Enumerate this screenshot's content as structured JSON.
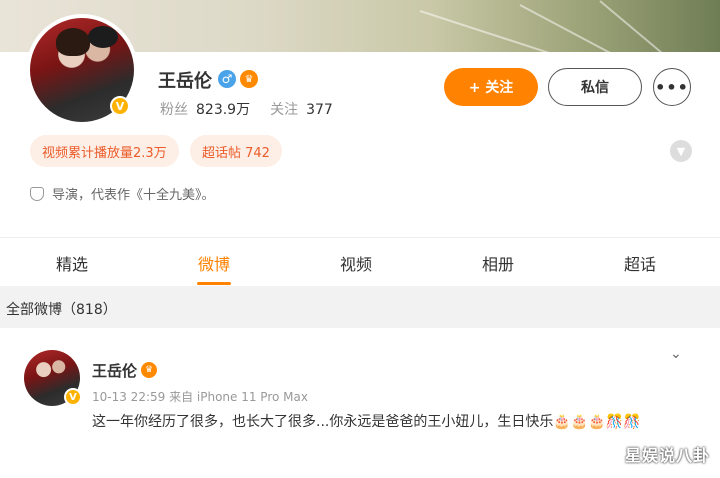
{
  "profile": {
    "name": "王岳伦",
    "followers_label": "粉丝",
    "followers_value": "823.9万",
    "following_label": "关注",
    "following_value": "377",
    "verified_badge": "V",
    "tags": [
      "视频累计播放量2.3万",
      "超话帖 742"
    ],
    "bio": "导演，代表作《十全九美》。"
  },
  "actions": {
    "follow": "+ 关注",
    "message": "私信",
    "more": "•••"
  },
  "icons": {
    "gender": "male-icon",
    "crown": "crown-icon",
    "expand": "chevron-down-icon",
    "bio": "shield-icon"
  },
  "tabs": [
    "精选",
    "微博",
    "视频",
    "相册",
    "超话"
  ],
  "active_tab": "微博",
  "weibo_count": "全部微博（818）",
  "post": {
    "author": "王岳伦",
    "meta": "10-13 22:59  来自 iPhone 11 Pro Max",
    "text": "这一年你经历了很多，也长大了很多...你永远是爸爸的王小妞儿，生日快乐🎂🎂🎂🎊🎊"
  },
  "watermark": "星娱说八卦",
  "colors": {
    "accent": "#ff8200",
    "tag_bg": "#fdeee6",
    "tag_text": "#ea5c2a",
    "verified": "#ffb300"
  }
}
